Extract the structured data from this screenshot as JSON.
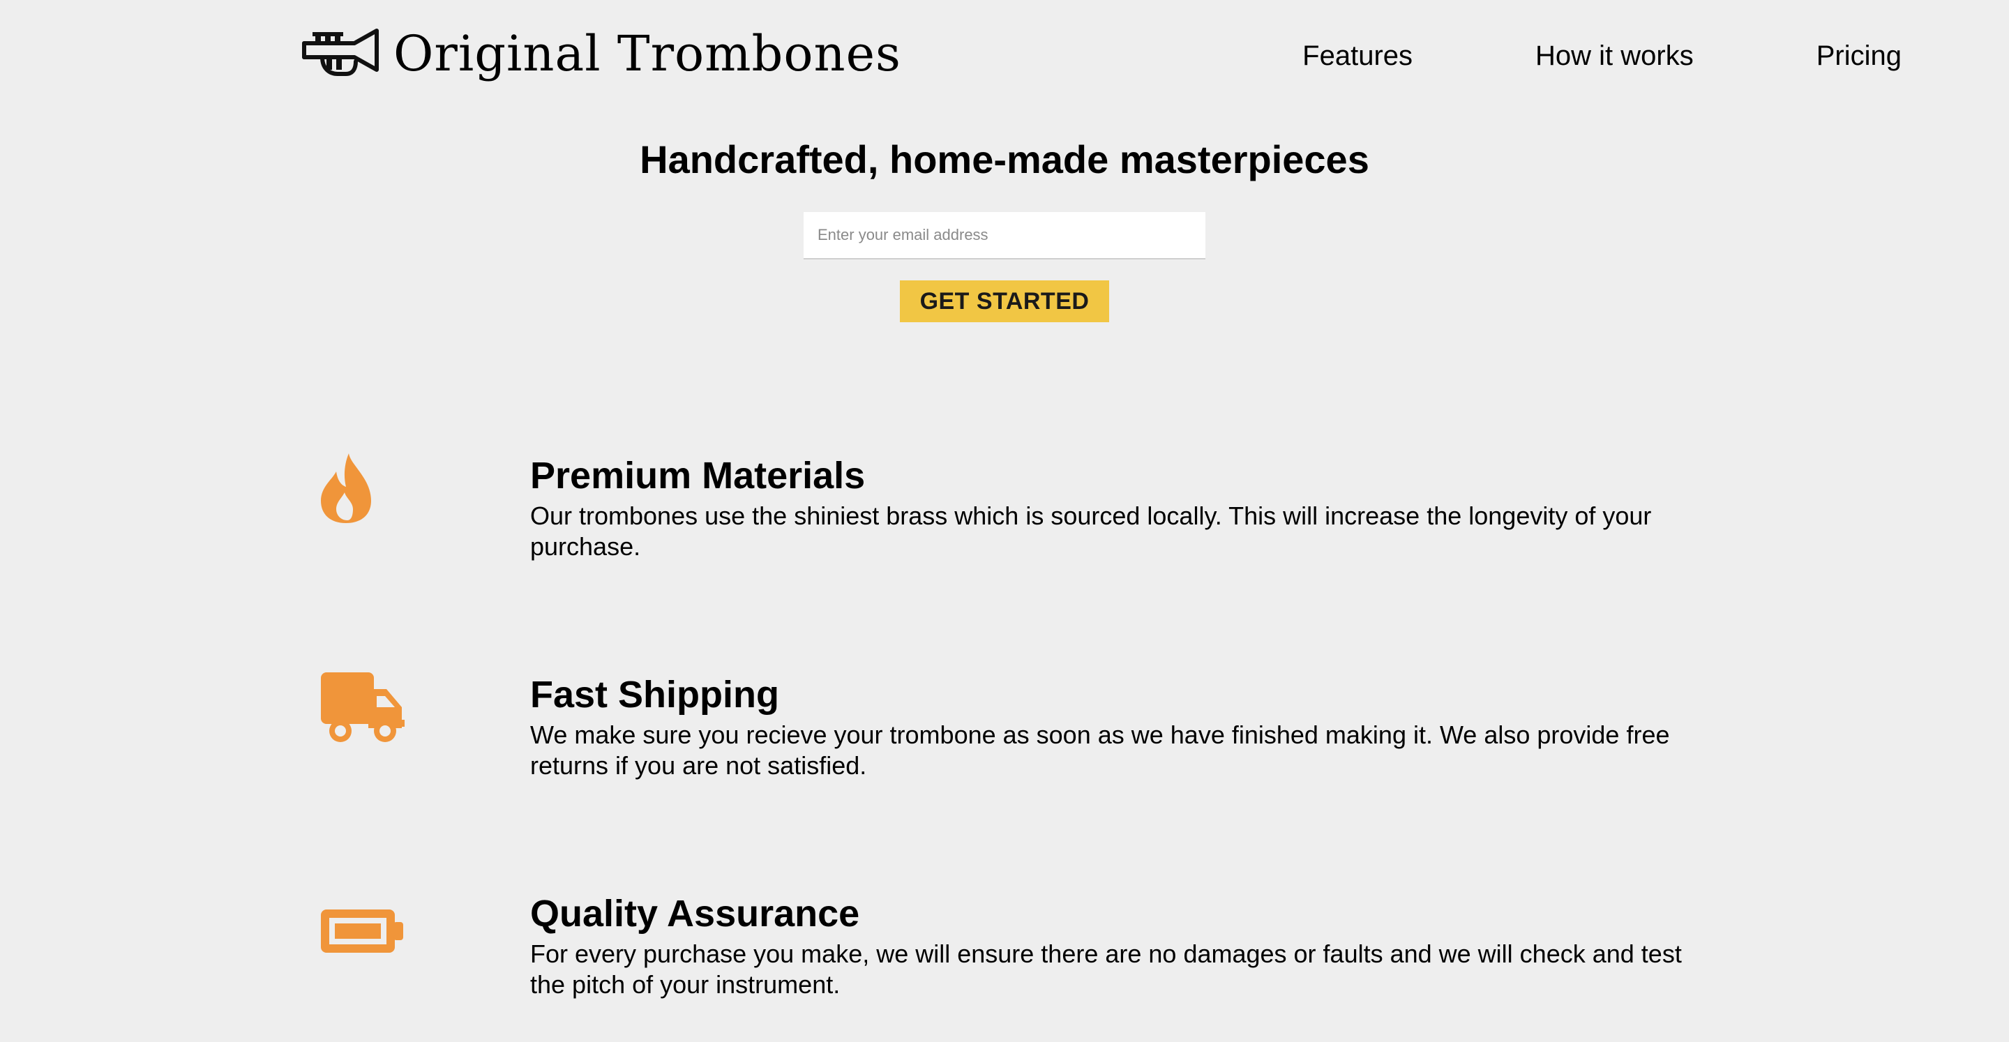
{
  "brand": {
    "name": "Original Trombones",
    "logo_icon": "trumpet-icon"
  },
  "nav": {
    "items": [
      {
        "label": "Features"
      },
      {
        "label": "How it works"
      },
      {
        "label": "Pricing"
      }
    ]
  },
  "hero": {
    "title": "Handcrafted, home-made masterpieces",
    "email_placeholder": "Enter your email address",
    "email_value": "",
    "cta_label": "GET STARTED"
  },
  "features": [
    {
      "icon": "fire-icon",
      "title": "Premium Materials",
      "description": "Our trombones use the shiniest brass which is sourced locally. This will increase the longevity of your purchase."
    },
    {
      "icon": "truck-icon",
      "title": "Fast Shipping",
      "description": "We make sure you recieve your trombone as soon as we have finished making it. We also provide free returns if you are not satisfied."
    },
    {
      "icon": "battery-icon",
      "title": "Quality Assurance",
      "description": "For every purchase you make, we will ensure there are no damages or faults and we will check and test the pitch of your instrument."
    }
  ],
  "colors": {
    "background": "#eeeeee",
    "accent_button": "#f1c644",
    "icon_orange": "#f0953a",
    "text": "#000000"
  }
}
